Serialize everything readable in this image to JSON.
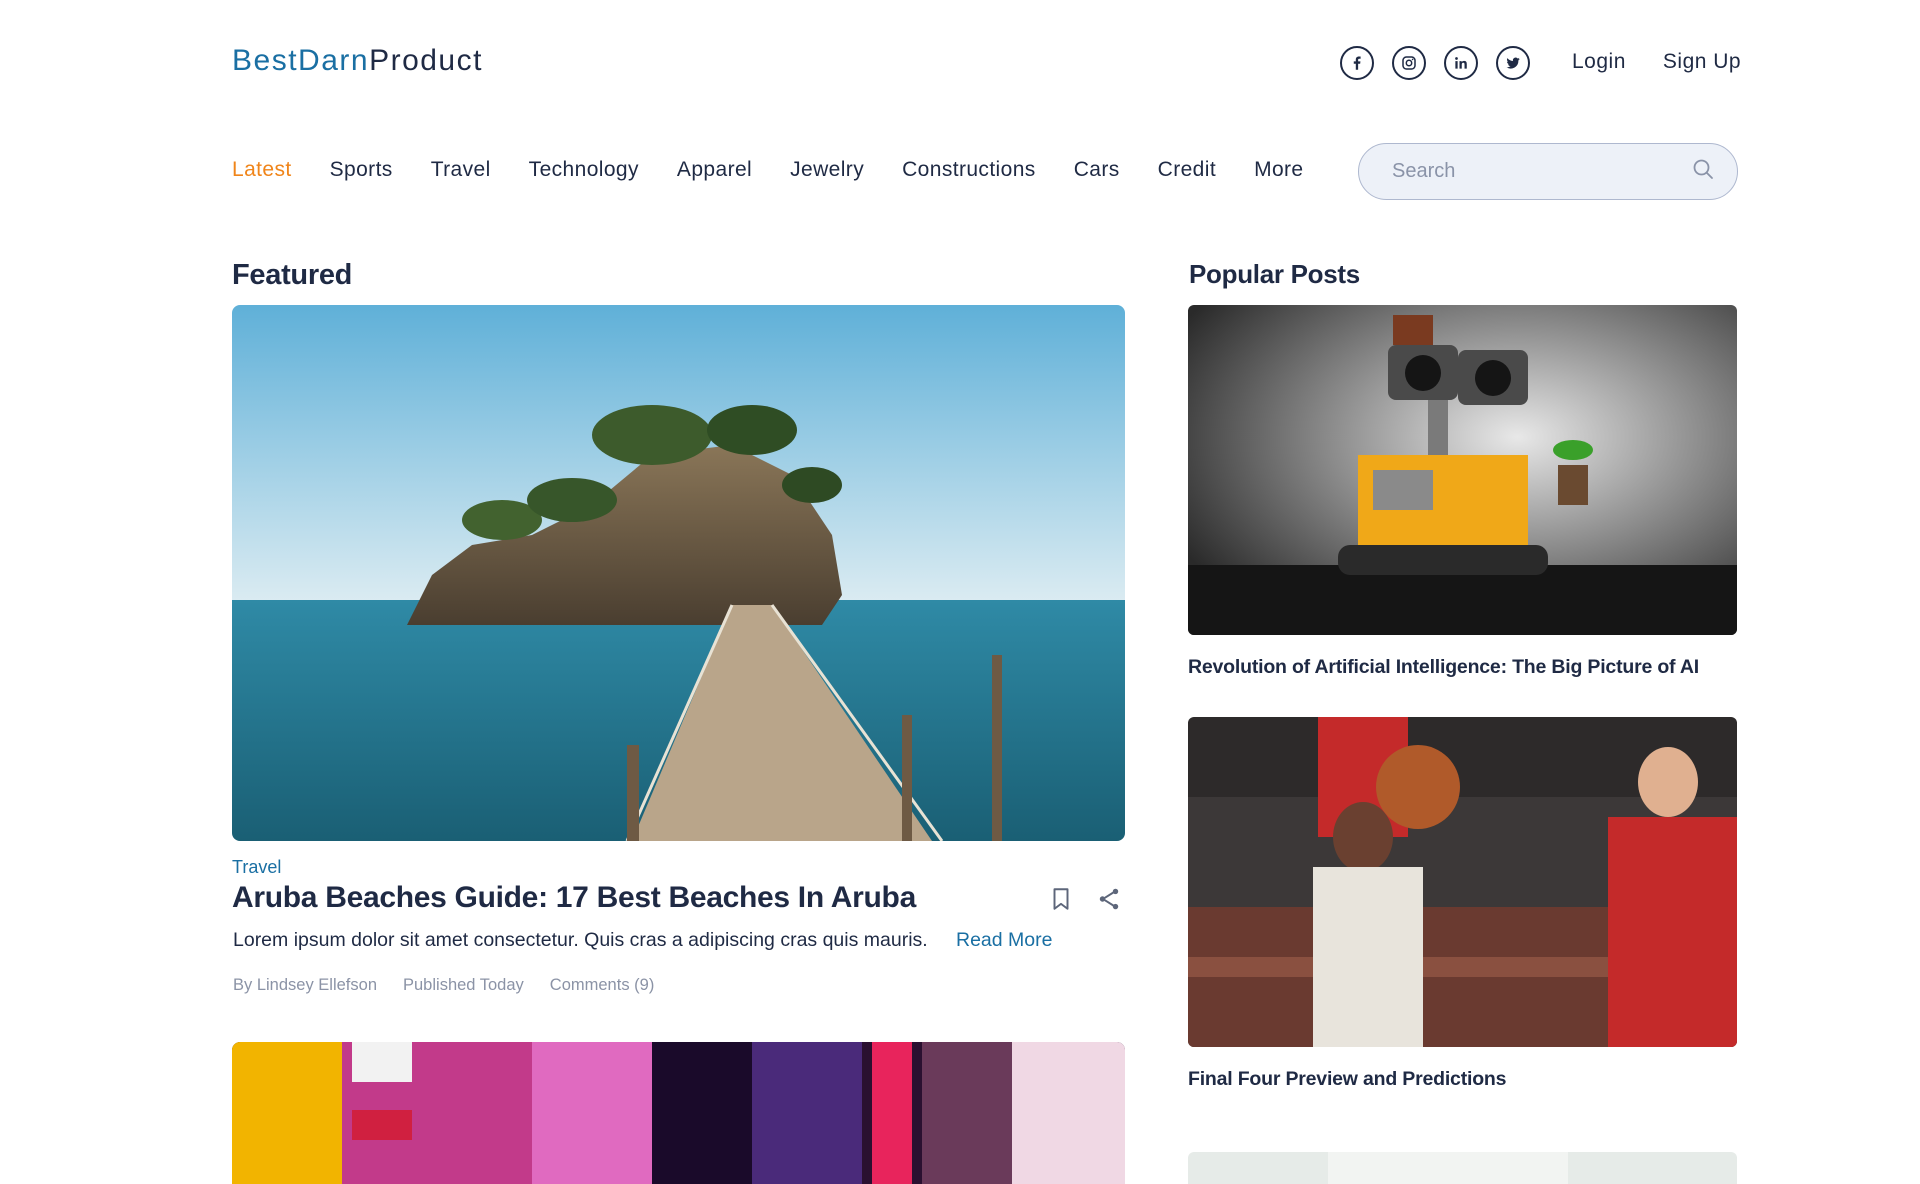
{
  "header": {
    "logo_part1": "BestDarn",
    "logo_part2": "Product",
    "socials": [
      "facebook-icon",
      "instagram-icon",
      "linkedin-icon",
      "twitter-icon"
    ],
    "login_label": "Login",
    "signup_label": "Sign Up"
  },
  "nav": {
    "items": [
      "Latest",
      "Sports",
      "Travel",
      "Technology",
      "Apparel",
      "Jewelry",
      "Constructions",
      "Cars",
      "Credit",
      "More"
    ],
    "active": "Latest"
  },
  "search": {
    "placeholder": "Search"
  },
  "featured": {
    "section_title": "Featured",
    "category": "Travel",
    "title": "Aruba Beaches Guide: 17 Best Beaches In Aruba",
    "description": "Lorem ipsum dolor sit amet consectetur. Quis cras a adipiscing cras quis mauris.",
    "read_more": "Read More",
    "author": "By Lindsey Ellefson",
    "published": "Published Today",
    "comments": "Comments (9)"
  },
  "popular": {
    "section_title": "Popular Posts",
    "posts": [
      {
        "title": "Revolution of Artificial Intelligence: The Big Picture of AI"
      },
      {
        "title": "Final Four Preview and Predictions"
      }
    ]
  },
  "colors": {
    "brand_blue": "#1a6fa3",
    "active_orange": "#f0851a",
    "text_dark": "#1f2a44",
    "meta_gray": "#8b93a6"
  }
}
